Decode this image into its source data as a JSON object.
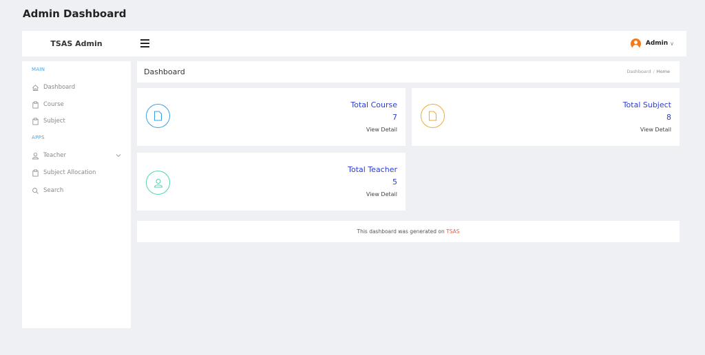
{
  "page": {
    "heading": "Admin Dashboard"
  },
  "topbar": {
    "brand": "TSAS Admin",
    "menu_icon": "hamburger-icon",
    "user": {
      "name": "Admin",
      "avatar_icon": "user-avatar-icon",
      "caret": "∨",
      "avatar_color": "#f07b1f"
    }
  },
  "sidebar": {
    "sections": [
      {
        "label": "MAIN",
        "items": [
          {
            "label": "Dashboard",
            "icon": "home-icon"
          },
          {
            "label": "Course",
            "icon": "clipboard-icon"
          },
          {
            "label": "Subject",
            "icon": "clipboard-icon"
          }
        ]
      },
      {
        "label": "APPS",
        "items": [
          {
            "label": "Teacher",
            "icon": "user-icon",
            "has_submenu": true
          },
          {
            "label": "Subject Allocation",
            "icon": "clipboard-icon"
          },
          {
            "label": "Search",
            "icon": "search-icon"
          }
        ]
      }
    ]
  },
  "content": {
    "title": "Dashboard",
    "breadcrumb": [
      "Dashboard",
      "Home"
    ],
    "breadcrumb_sep": "/"
  },
  "cards": [
    {
      "title": "Total Course",
      "value": "7",
      "link": "View Detail",
      "icon": "file-icon",
      "color": "#3aa0e4",
      "title_color": "#2b3bd6"
    },
    {
      "title": "Total Subject",
      "value": "8",
      "link": "View Detail",
      "icon": "file-icon",
      "color": "#f0a93a",
      "title_color": "#2b3bd6"
    },
    {
      "title": "Total Teacher",
      "value": "5",
      "link": "View Detail",
      "icon": "user-icon",
      "color": "#4fd3b4",
      "title_color": "#2b3bd6"
    }
  ],
  "footer": {
    "text": "This dashboard was generated on ",
    "brand": "TSAS",
    "brand_color": "#e55b4d"
  }
}
